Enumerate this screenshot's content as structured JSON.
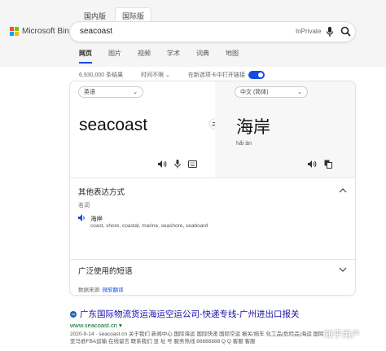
{
  "header": {
    "region_tabs": [
      "国内版",
      "国际版"
    ],
    "active_region": 1,
    "logo_text": "Microsoft Bing",
    "logo_colors": [
      "#f35325",
      "#81bc06",
      "#05a6f0",
      "#ffba08"
    ],
    "search_value": "seacoast",
    "inprivate_label": "InPrivate",
    "nav_tabs": [
      "网页",
      "图片",
      "视频",
      "学术",
      "词典",
      "地图"
    ],
    "active_nav": 0
  },
  "meta": {
    "results_count": "6,930,000 条结果",
    "time_filter": "时间不限",
    "open_new_tab": "在新选项卡中打开链接",
    "open_new_tab_on": true,
    "accent_color": "#174ae4"
  },
  "translator": {
    "source_lang": "英语",
    "target_lang": "中文 (简体)",
    "source_text": "seacoast",
    "target_text": "海岸",
    "pinyin": "hǎi àn",
    "other_expressions_title": "其他表达方式",
    "part_of_speech": "名词",
    "alt_translation": "海岸",
    "alt_synonyms": "coast, shore, coastal, marine, seashore, seaboard",
    "common_phrases_title": "广泛使用的短语",
    "data_source_label": "数据来源:",
    "data_source_link": "微软翻译"
  },
  "result": {
    "title": "广东国际物流货运海运空运公司-快递专线-广州进出口报关",
    "url": "www.seacoast.cn",
    "snippet_line1": "2020-9-14 · seacoast.cn 关于我们 新闻中心 国际海运 国际快递 国际空运 报关/拖车 化工品(危险品)海运 国际",
    "snippet_line2": "亚马逊FBA运输 在线留言 联系我们 显 址 号 服务热线 88888888 Q Q 客服 客服"
  },
  "watermark_text": "知乎用户"
}
